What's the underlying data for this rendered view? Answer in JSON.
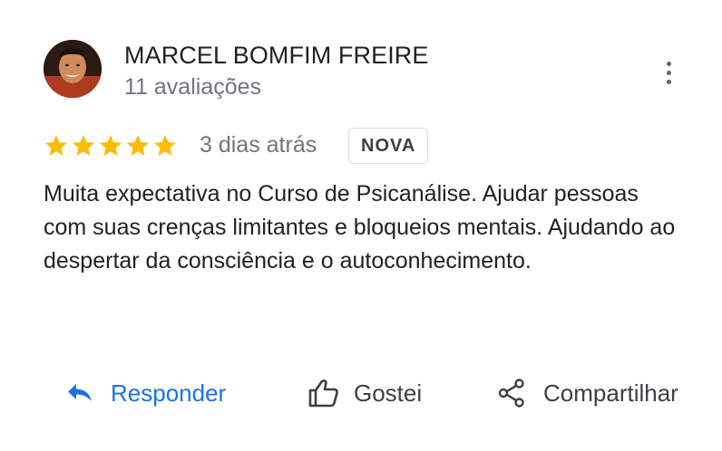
{
  "reviewer": {
    "name": "MARCEL BOMFIM FREIRE",
    "review_count": "11 avaliações"
  },
  "review": {
    "rating": 5,
    "rating_max": 5,
    "date": "3 dias atrás",
    "badge": "NOVA",
    "text": "Muita expectativa no Curso de Psicanálise. Ajudar pessoas com suas crenças limitantes e bloqueios mentais. Ajudando ao despertar da consciência e o autoconhecimento."
  },
  "actions": {
    "reply_label": "Responder",
    "like_label": "Gostei",
    "share_label": "Compartilhar"
  },
  "colors": {
    "star": "#fbbc04",
    "link": "#1a73e8",
    "secondary_text": "#70757a",
    "primary_text": "#202124"
  },
  "icons": {
    "menu": "more-vert-icon",
    "star": "star-icon",
    "reply": "reply-icon",
    "like": "thumb-up-icon",
    "share": "share-icon"
  }
}
